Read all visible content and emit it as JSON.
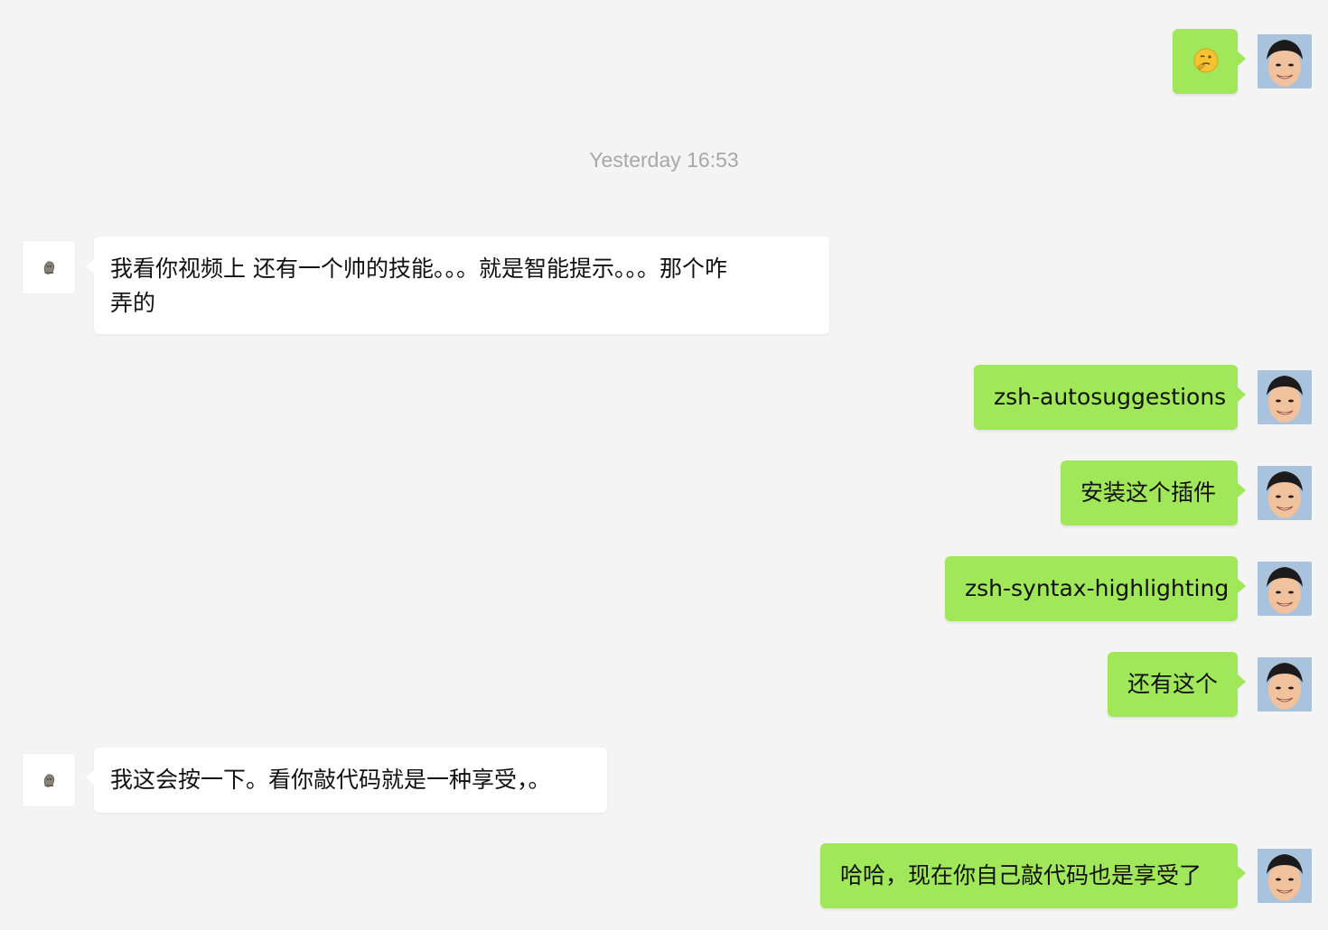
{
  "messages": [
    {
      "sender": "me",
      "kind": "emoji",
      "emoji": "thinking-face-emoji"
    },
    {
      "kind": "timestamp",
      "text": "Yesterday 16:53"
    },
    {
      "sender": "other",
      "line1": "我看你视频上 还有一个帅的技能。。。就是智能提示。。。那个咋",
      "line2": "弄的"
    },
    {
      "sender": "me",
      "text": "zsh-autosuggestions"
    },
    {
      "sender": "me",
      "text": "安装这个插件"
    },
    {
      "sender": "me",
      "text": "zsh-syntax-highlighting"
    },
    {
      "sender": "me",
      "text": "还有这个"
    },
    {
      "sender": "other",
      "text": "我这会按一下。看你敲代码就是一种享受，。"
    },
    {
      "sender": "me",
      "text": "哈哈，现在你自己敲代码也是享受了"
    }
  ],
  "colors": {
    "background": "#f4f4f4",
    "outgoing_bubble": "#a0e75a",
    "incoming_bubble": "#ffffff",
    "timestamp_text": "#a8a8a8"
  }
}
